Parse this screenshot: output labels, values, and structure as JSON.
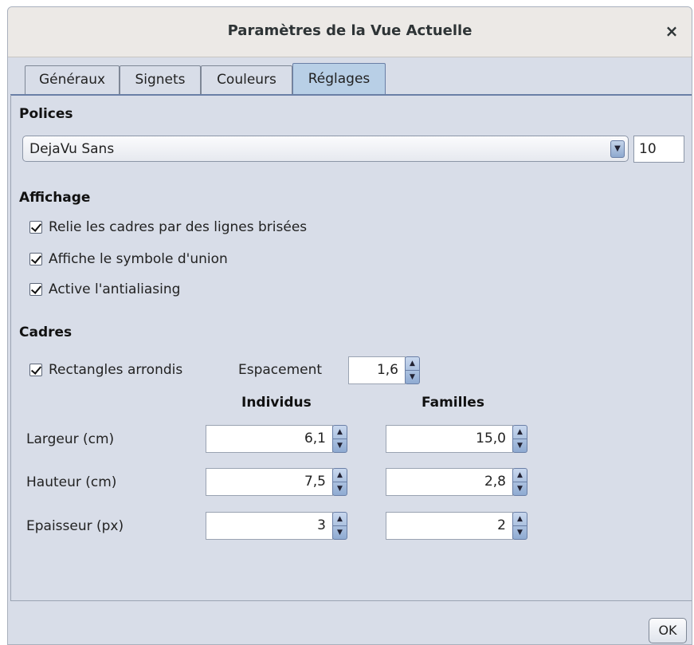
{
  "window": {
    "title": "Paramètres de la Vue Actuelle",
    "close_glyph": "×"
  },
  "tabs": [
    {
      "label": "Généraux",
      "active": false
    },
    {
      "label": "Signets",
      "active": false
    },
    {
      "label": "Couleurs",
      "active": false
    },
    {
      "label": "Réglages",
      "active": true
    }
  ],
  "fonts": {
    "section_title": "Polices",
    "font_family": "DejaVu Sans",
    "font_size": "10"
  },
  "display": {
    "section_title": "Affichage",
    "options": [
      {
        "label": "Relie les cadres par des lignes brisées",
        "checked": true
      },
      {
        "label": "Affiche le symbole d'union",
        "checked": true
      },
      {
        "label": "Active l'antialiasing",
        "checked": true
      }
    ]
  },
  "frames": {
    "section_title": "Cadres",
    "rounded": {
      "label": "Rectangles arrondis",
      "checked": true
    },
    "spacing": {
      "label": "Espacement",
      "value": "1,6"
    },
    "col_individuals": "Individus",
    "col_families": "Familles",
    "rows": [
      {
        "label": "Largeur (cm)",
        "individus": "6,1",
        "familles": "15,0"
      },
      {
        "label": "Hauteur (cm)",
        "individus": "7,5",
        "familles": "2,8"
      },
      {
        "label": "Epaisseur (px)",
        "individus": "3",
        "familles": "2"
      }
    ]
  },
  "footer": {
    "ok_label": "OK"
  },
  "colors": {
    "dialog_bg": "#d8dde8",
    "accent": "#6a7fa6",
    "active_tab": "#b8cfe6"
  },
  "icons": {
    "spin_up": "spinner-up-icon",
    "spin_down": "spinner-down-icon",
    "combo": "dropdown-arrow-icon"
  }
}
